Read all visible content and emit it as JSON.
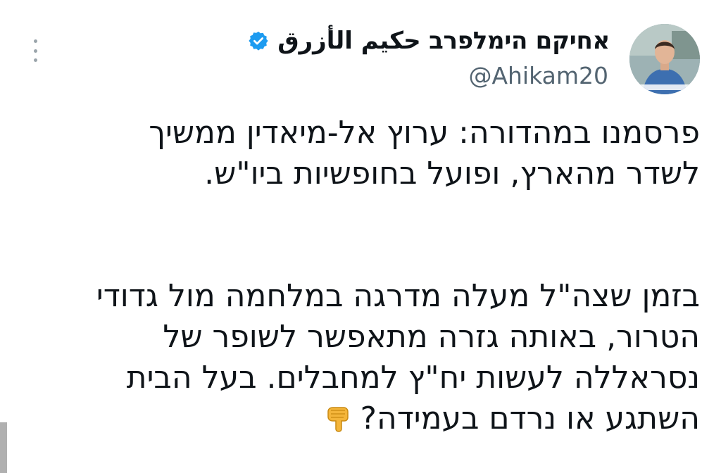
{
  "tweet": {
    "author": {
      "display_name": "אחיקם הימלפרב حكيم الأزرق",
      "handle": "@Ahikam20",
      "verified": true,
      "avatar": "profile-photo"
    },
    "text_lines_p1": [
      "פרסמנו במהדורה: ערוץ אל-מיאדין ממשיך",
      "לשדר מהארץ, ופועל בחופשיות ביו\"ש."
    ],
    "text_lines_p2": [
      "בזמן שצה\"ל מעלה מדרגה במלחמה מול גדודי",
      "הטרור, באותה גזרה מתאפשר לשופר של",
      "נסראללה לעשות יח\"ץ למחבלים. בעל הבית",
      "השתגע או נרדם בעמידה?"
    ],
    "emoji": "backhand-index-pointing-down",
    "icons": {
      "more": "more-vertical-icon",
      "verified": "verified-badge-icon"
    },
    "colors": {
      "text": "#0f1419",
      "secondary": "#536471",
      "verified": "#1d9bf0"
    }
  }
}
